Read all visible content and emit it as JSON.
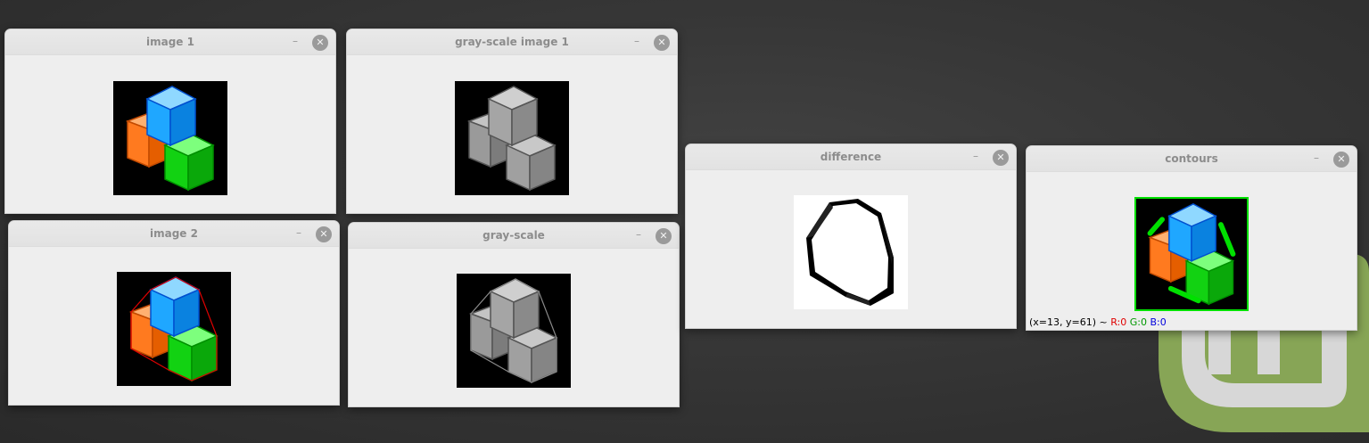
{
  "windows": {
    "image1": {
      "title": "image 1"
    },
    "gray1": {
      "title": "gray-scale image 1"
    },
    "image2": {
      "title": "image 2"
    },
    "gray2": {
      "title": "gray-scale"
    },
    "difference": {
      "title": "difference"
    },
    "contours": {
      "title": "contours"
    }
  },
  "controls": {
    "minimize": "–",
    "close": "✕"
  },
  "status": {
    "coords": "(x=13, y=61) ~",
    "r": "R:0",
    "g": "G:0",
    "b": "B:0"
  },
  "colors": {
    "blue_cube": "#1fa7ff",
    "orange_cube": "#ff7a1f",
    "green_cube": "#12d212",
    "hull_red": "#e00000",
    "contour_green": "#00e000"
  },
  "icons": [
    "minimize-icon",
    "close-icon",
    "linux-mint-logo"
  ]
}
